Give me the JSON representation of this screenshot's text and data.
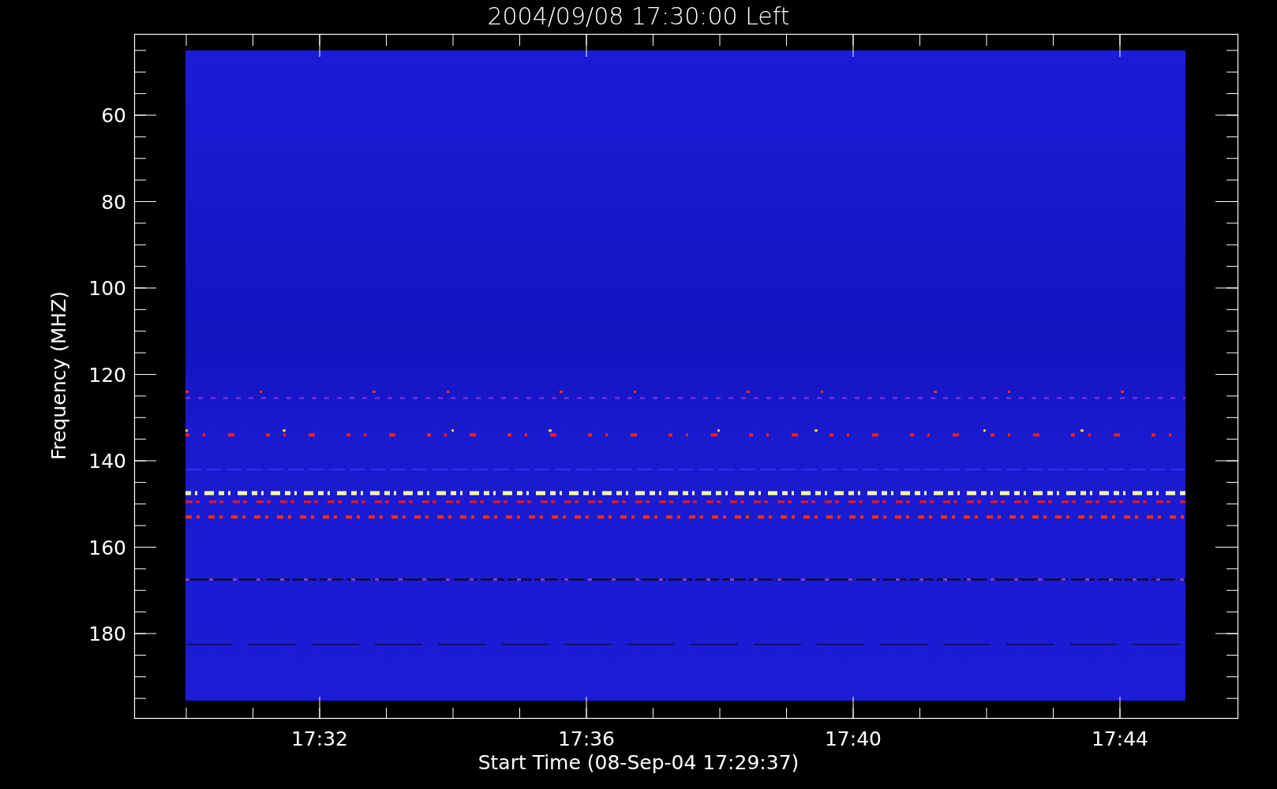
{
  "title": "2004/09/08 17:30:00 Left",
  "y_axis": {
    "label": "Frequency (MHZ)",
    "ticks": [
      "60",
      "80",
      "100",
      "120",
      "140",
      "160",
      "180"
    ]
  },
  "x_axis": {
    "label": "Start Time (08-Sep-04 17:29:37)",
    "ticks": [
      "17:32",
      "17:36",
      "17:40",
      "17:44"
    ]
  }
}
